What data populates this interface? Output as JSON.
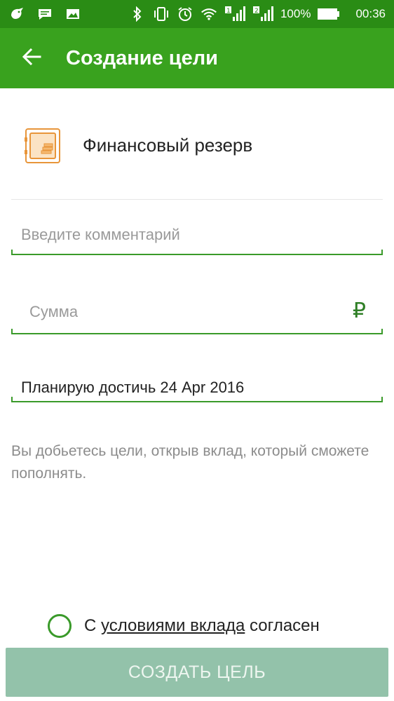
{
  "status_bar": {
    "battery_percent": "100%",
    "time": "00:36",
    "icons": [
      "bird-icon",
      "chat-icon",
      "image-icon",
      "bluetooth-icon",
      "vibrate-icon",
      "alarm-icon",
      "wifi-icon",
      "signal-1-icon",
      "signal-2-icon",
      "battery-icon"
    ]
  },
  "toolbar": {
    "back_icon": "arrow-left-icon",
    "title": "Создание цели"
  },
  "goal": {
    "icon": "safe-icon",
    "name": "Финансовый резерв"
  },
  "form": {
    "comment_placeholder": "Введите комментарий",
    "comment_value": "",
    "sum_placeholder": "Сумма",
    "sum_value": "",
    "currency_symbol": "₽",
    "date_text": "Планирую достичь 24 Apr 2016"
  },
  "hint": "Вы добьетесь цели, открыв вклад, который сможете пополнять.",
  "agreement": {
    "prefix": "С ",
    "link": "условиями вклада",
    "suffix": " согласен",
    "checked": false
  },
  "submit_label": "СОЗДАТЬ ЦЕЛЬ",
  "colors": {
    "status_bar": "#2a8c15",
    "toolbar": "#39a21e",
    "accent": "#3a9a2a",
    "button_disabled": "#93c2aa",
    "icon_orange": "#e8953a"
  }
}
